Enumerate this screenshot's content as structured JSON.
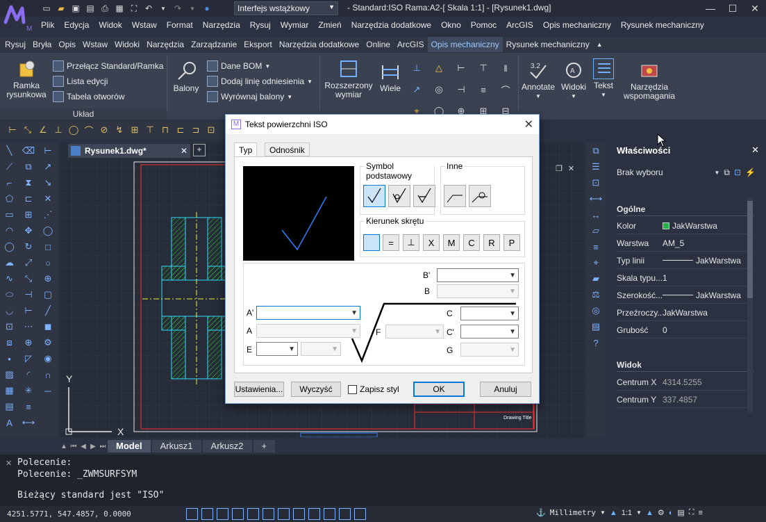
{
  "app": {
    "workspace": "Interfejs wstążkowy",
    "title": "- Standard:ISO Rama:A2-[ Skala 1:1] - [Rysunek1.dwg]"
  },
  "menu": [
    "Plik",
    "Edycja",
    "Widok",
    "Wstaw",
    "Format",
    "Narzędzia",
    "Rysuj",
    "Wymiar",
    "Zmień",
    "Narzędzia dodatkowe",
    "Okno",
    "Pomoc",
    "ArcGIS",
    "Opis mechaniczny",
    "Rysunek mechaniczny"
  ],
  "ribbon_tabs": [
    "Rysuj",
    "Bryła",
    "Opis",
    "Wstaw",
    "Widoki",
    "Narzędzia",
    "Zarządzanie",
    "Eksport",
    "Narzędzia dodatkowe",
    "Online",
    "ArcGIS",
    "Opis mechaniczny",
    "Rysunek mechaniczny"
  ],
  "ribbon_active_tab": "Opis mechaniczny",
  "ribbon": {
    "ramka_l1": "Ramka",
    "ramka_l2": "rysunkowa",
    "przelacz": "Przełącz Standard/Ramka",
    "lista": "Lista edycji",
    "tabela": "Tabela otworów",
    "uklad": "Układ",
    "balony": "Balony",
    "dane_bom": "Dane BOM",
    "dodaj_linie": "Dodaj linię odniesienia",
    "wyrownaj": "Wyrównaj balony",
    "rozszerzony_l1": "Rozszerzony",
    "rozszerzony_l2": "wymiar",
    "wiele": "Wiele",
    "annotate": "Annotate",
    "widoki": "Widoki",
    "tekst": "Tekst",
    "narzedzia_l1": "Narzędzia",
    "narzedzia_l2": "wspomagania"
  },
  "document_tab": "Rysunek1.dwg*",
  "drawing": {
    "axis_y": "Y",
    "axis_x": "X",
    "title_block_text": "Drawing Title"
  },
  "layout_tabs": [
    "Model",
    "Arkusz1",
    "Arkusz2"
  ],
  "layout_active": "Model",
  "properties": {
    "title": "Właściwości",
    "selection": "Brak wyboru",
    "section_general": "Ogólne",
    "rows": [
      {
        "label": "Kolor",
        "value": "JakWarstwa"
      },
      {
        "label": "Warstwa",
        "value": "AM_5"
      },
      {
        "label": "Typ linii",
        "value": "JakWarstwa"
      },
      {
        "label": "Skala typu...",
        "value": "1"
      },
      {
        "label": "Szerokość...",
        "value": "JakWarstwa"
      },
      {
        "label": "Przeźroczy...",
        "value": "JakWarstwa"
      },
      {
        "label": "Grubość",
        "value": "0"
      }
    ],
    "section_view": "Widok",
    "view_rows": [
      {
        "label": "Centrum X",
        "value": "4314.5255"
      },
      {
        "label": "Centrum Y",
        "value": "337.4857"
      }
    ],
    "color_swatch": "#22b34a"
  },
  "command": {
    "lines": [
      "Polecenie:",
      "Polecenie: _ZWMSURFSYM"
    ],
    "status_message": "Bieżący standard jest \"ISO\""
  },
  "status": {
    "coords": "4251.5771, 547.4857, 0.0000",
    "units": "Millimetry",
    "scale": "1:1"
  },
  "dialog": {
    "title": "Tekst powierzchni ISO",
    "tabs": [
      "Typ",
      "Odnośnik"
    ],
    "group_basic": "Symbol podstawowy",
    "group_other": "Inne",
    "group_lay": "Kierunek skrętu",
    "lay_symbols": [
      "=",
      "⊥",
      "X",
      "M",
      "C",
      "R",
      "P"
    ],
    "labels": {
      "bprime": "B'",
      "b": "B",
      "aprime": "A'",
      "a": "A",
      "e": "E",
      "f": "F",
      "c": "C",
      "cprime": "C'",
      "g": "G"
    },
    "buttons": {
      "settings": "Ustawienia...",
      "clear": "Wyczyść",
      "save_style": "Zapisz styl",
      "ok": "OK",
      "cancel": "Anuluj"
    }
  }
}
